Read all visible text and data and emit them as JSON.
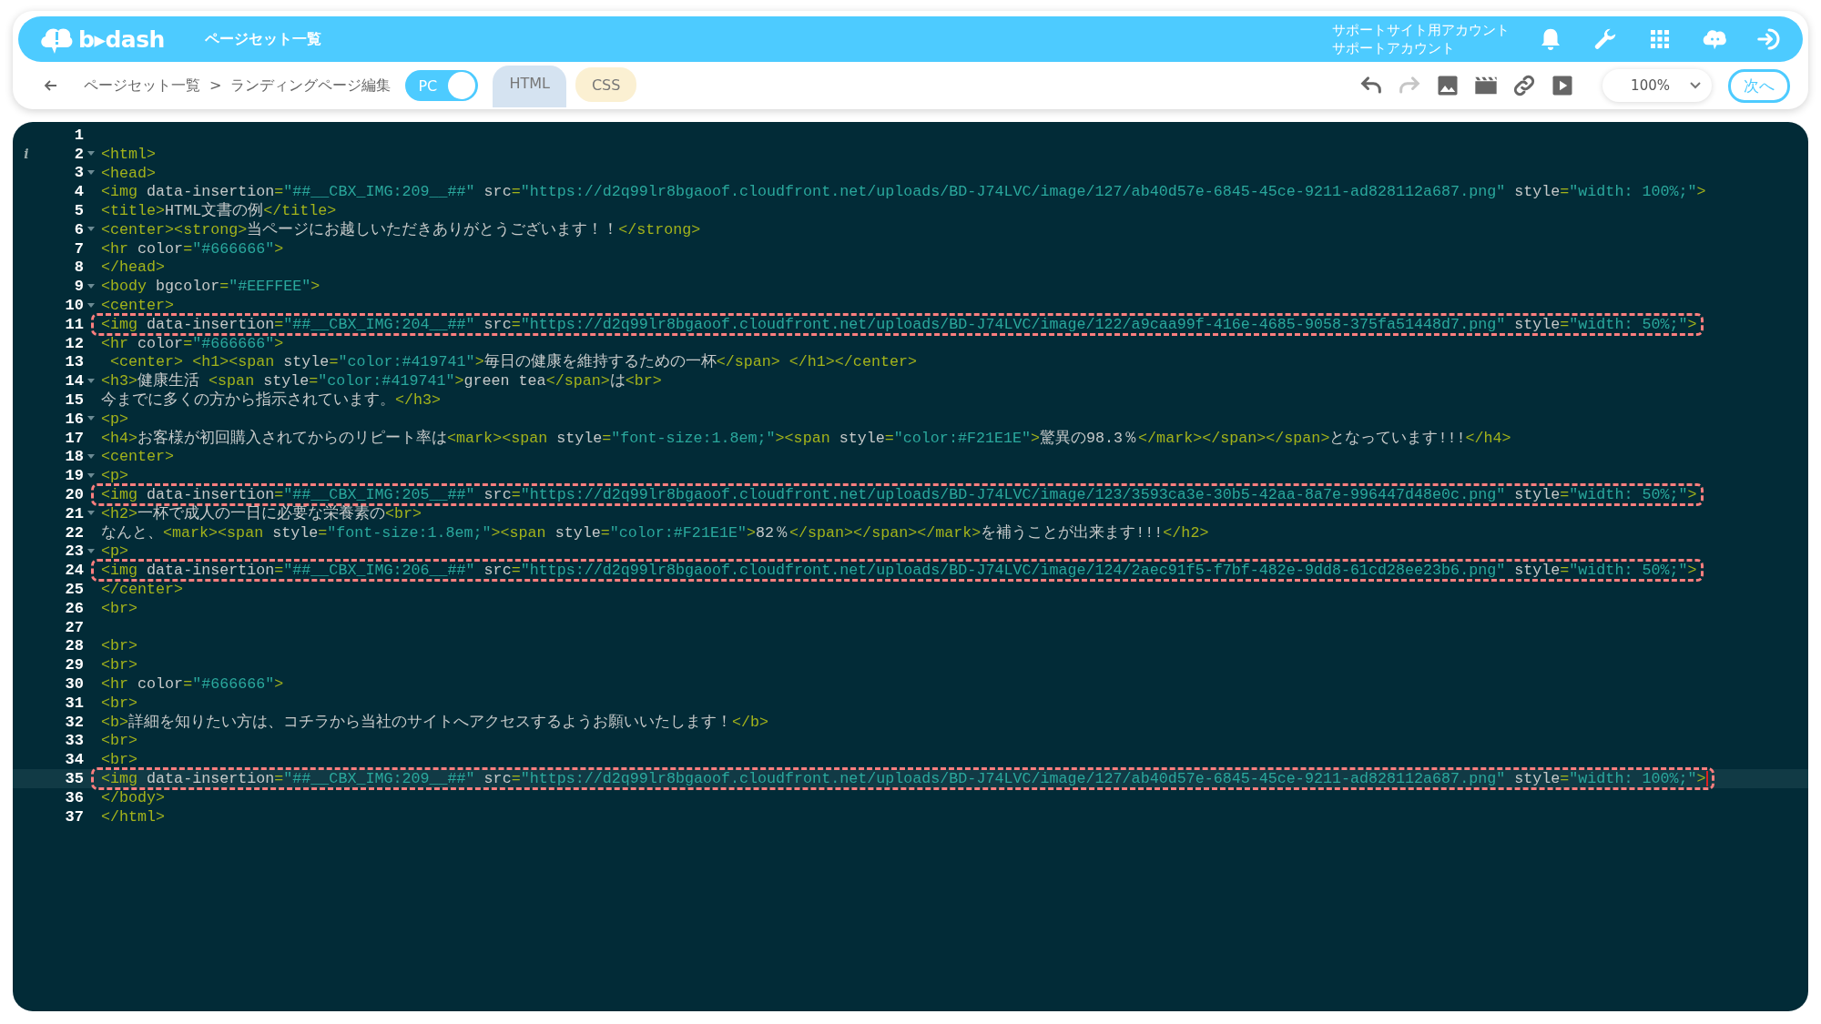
{
  "header": {
    "logo": "b▸dash",
    "title": "ページセット一覧",
    "account_lines": [
      "サポートサイト用アカウント",
      "サポートアカウント"
    ],
    "icons": [
      {
        "kind": "bell"
      },
      {
        "kind": "wrench"
      },
      {
        "kind": "grid"
      },
      {
        "kind": "chat"
      },
      {
        "kind": "logout"
      }
    ]
  },
  "toolbar": {
    "breadcrumb": [
      "ページセット一覧",
      ">",
      "ランディングページ編集"
    ],
    "toggle": {
      "label": "PC",
      "on": true
    },
    "tabs": [
      {
        "label": "HTML",
        "selected": true,
        "color": "#d5e3f1"
      },
      {
        "label": "CSS",
        "selected": false,
        "color": "#fbf0d2"
      }
    ],
    "tools": [
      {
        "kind": "undo",
        "disabled": false
      },
      {
        "kind": "redo",
        "disabled": true
      },
      {
        "kind": "image",
        "disabled": false
      },
      {
        "kind": "clapper",
        "disabled": false
      },
      {
        "kind": "link",
        "disabled": false
      },
      {
        "kind": "play",
        "disabled": false
      }
    ],
    "zoom": "100%",
    "next_button": "次へ"
  },
  "editor": {
    "lines": [
      {
        "number": "1",
        "fold": false,
        "marked": false,
        "active": false
      },
      {
        "number": "2",
        "text": "<html>",
        "fold": true,
        "marked": false,
        "active": false,
        "annotation": "i"
      },
      {
        "number": "3",
        "text": "<head>",
        "fold": true,
        "marked": false,
        "active": false
      },
      {
        "number": "4",
        "text": "<img data-insertion=\"##__CBX_IMG:209__##\" src=\"https://d2q99lr8bgaoof.cloudfront.net/uploads/BD-J74LVC/image/127/ab40d57e-6845-45ce-9211-ad828112a687.png\" style=\"width: 100%;\">",
        "fold": false,
        "marked": false,
        "active": false
      },
      {
        "number": "5",
        "text": "<title>HTML文書の例</title>",
        "fold": false,
        "marked": false,
        "active": false
      },
      {
        "number": "6",
        "text": "<center><strong>当ページにお越しいただきありがとうございます！！</strong>",
        "fold": true,
        "marked": false,
        "active": false
      },
      {
        "number": "7",
        "text": "<hr color=\"#666666\">",
        "fold": false,
        "marked": false,
        "active": false
      },
      {
        "number": "8",
        "text": "</head>",
        "fold": false,
        "marked": false,
        "active": false
      },
      {
        "number": "9",
        "text": "<body bgcolor=\"#EEFFEE\">",
        "fold": true,
        "marked": false,
        "active": false
      },
      {
        "number": "10",
        "text": "<center>",
        "fold": true,
        "marked": false,
        "active": false
      },
      {
        "number": "11",
        "text": "<img data-insertion=\"##__CBX_IMG:204__##\" src=\"https://d2q99lr8bgaoof.cloudfront.net/uploads/BD-J74LVC/image/122/a9caa99f-416e-4685-9058-375fa51448d7.png\" style=\"width: 50%;\">",
        "fold": false,
        "marked": true,
        "active": false
      },
      {
        "number": "12",
        "text": "<hr color=\"#666666\">",
        "fold": false,
        "marked": false,
        "active": false
      },
      {
        "number": "13",
        "text": " <center> <h1><span style=\"color:#419741\">毎日の健康を維持するための一杯</span> </h1></center>",
        "fold": false,
        "marked": false,
        "active": false
      },
      {
        "number": "14",
        "text": "<h3>健康生活 <span style=\"color:#419741\">green tea</span>は<br>",
        "fold": true,
        "marked": false,
        "active": false
      },
      {
        "number": "15",
        "text": "今までに多くの方から指示されています。</h3>",
        "fold": false,
        "marked": false,
        "active": false
      },
      {
        "number": "16",
        "text": "<p>",
        "fold": true,
        "marked": false,
        "active": false
      },
      {
        "number": "17",
        "text": "<h4>お客様が初回購入されてからのリピート率は<mark><span style=\"font-size:1.8em;\"><span style=\"color:#F21E1E\">驚異の98.3％</mark></span></span>となっています!!!</h4>",
        "fold": false,
        "marked": false,
        "active": false
      },
      {
        "number": "18",
        "text": "<center>",
        "fold": true,
        "marked": false,
        "active": false
      },
      {
        "number": "19",
        "text": "<p>",
        "fold": true,
        "marked": false,
        "active": false
      },
      {
        "number": "20",
        "text": "<img data-insertion=\"##__CBX_IMG:205__##\" src=\"https://d2q99lr8bgaoof.cloudfront.net/uploads/BD-J74LVC/image/123/3593ca3e-30b5-42aa-8a7e-996447d48e0c.png\" style=\"width: 50%;\">",
        "fold": false,
        "marked": true,
        "active": false
      },
      {
        "number": "21",
        "text": "<h2>一杯で成人の一日に必要な栄養素の<br>",
        "fold": true,
        "marked": false,
        "active": false
      },
      {
        "number": "22",
        "text": "なんと、<mark><span style=\"font-size:1.8em;\"><span style=\"color:#F21E1E\">82％</span></span></mark>を補うことが出来ます!!!</h2>",
        "fold": false,
        "marked": false,
        "active": false
      },
      {
        "number": "23",
        "text": "<p>",
        "fold": true,
        "marked": false,
        "active": false
      },
      {
        "number": "24",
        "text": "<img data-insertion=\"##__CBX_IMG:206__##\" src=\"https://d2q99lr8bgaoof.cloudfront.net/uploads/BD-J74LVC/image/124/2aec91f5-f7bf-482e-9dd8-61cd28ee23b6.png\" style=\"width: 50%;\">",
        "fold": false,
        "marked": true,
        "active": false
      },
      {
        "number": "25",
        "text": "</center>",
        "fold": false,
        "marked": false,
        "active": false
      },
      {
        "number": "26",
        "text": "<br>",
        "fold": false,
        "marked": false,
        "active": false
      },
      {
        "number": "27",
        "fold": false,
        "marked": false,
        "active": false
      },
      {
        "number": "28",
        "text": "<br>",
        "fold": false,
        "marked": false,
        "active": false
      },
      {
        "number": "29",
        "text": "<br>",
        "fold": false,
        "marked": false,
        "active": false
      },
      {
        "number": "30",
        "text": "<hr color=\"#666666\">",
        "fold": false,
        "marked": false,
        "active": false
      },
      {
        "number": "31",
        "text": "<br>",
        "fold": false,
        "marked": false,
        "active": false
      },
      {
        "number": "32",
        "text": "<b>詳細を知りたい方は、コチラから当社のサイトへアクセスするようお願いいたします！</b>",
        "fold": false,
        "marked": false,
        "active": false
      },
      {
        "number": "33",
        "text": "<br>",
        "fold": false,
        "marked": false,
        "active": false
      },
      {
        "number": "34",
        "text": "<br>",
        "fold": false,
        "marked": false,
        "active": false
      },
      {
        "number": "35",
        "text": "<img data-insertion=\"##__CBX_IMG:209__##\" src=\"https://d2q99lr8bgaoof.cloudfront.net/uploads/BD-J74LVC/image/127/ab40d57e-6845-45ce-9211-ad828112a687.png\" style=\"width: 100%;\">",
        "fold": false,
        "marked": true,
        "active": true
      },
      {
        "number": "36",
        "text": "</body>",
        "fold": false,
        "marked": false,
        "active": false
      },
      {
        "number": "37",
        "text": "</html>",
        "fold": false,
        "marked": false,
        "active": false
      }
    ]
  }
}
